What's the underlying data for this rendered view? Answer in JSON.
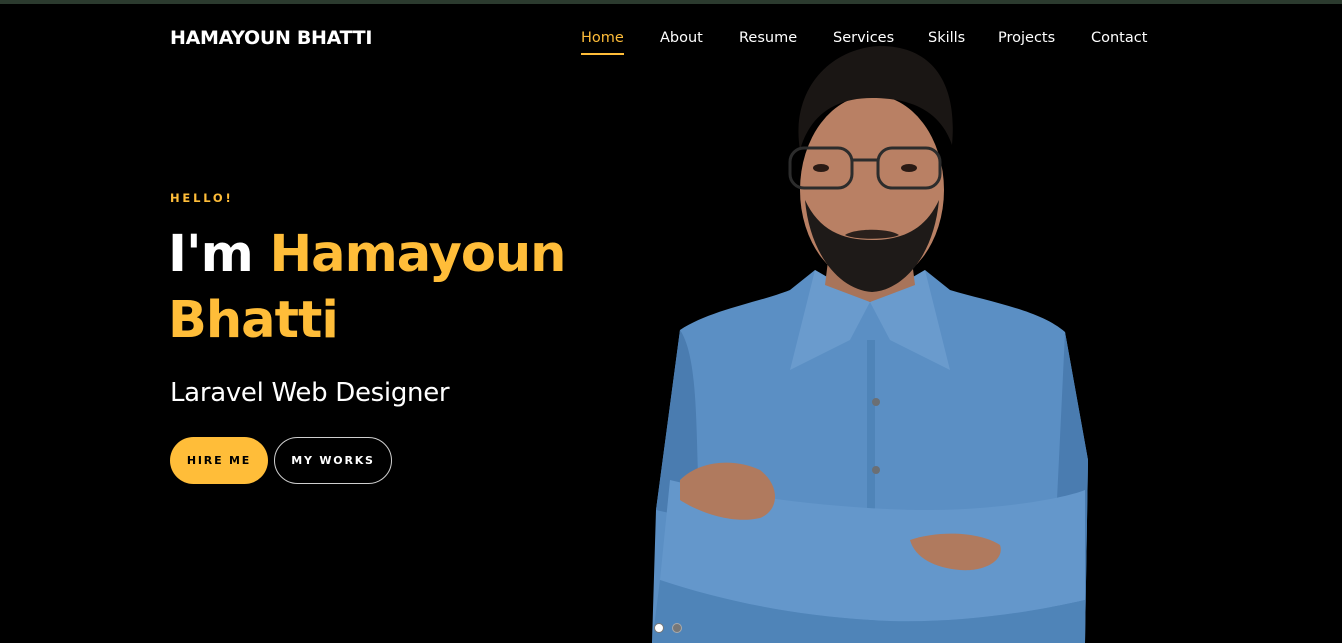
{
  "brand": {
    "name": "HAMAYOUN BHATTI"
  },
  "nav": {
    "items": [
      {
        "label": "Home",
        "active": true
      },
      {
        "label": "About",
        "active": false
      },
      {
        "label": "Resume",
        "active": false
      },
      {
        "label": "Services",
        "active": false
      },
      {
        "label": "Skills",
        "active": false
      },
      {
        "label": "Projects",
        "active": false
      },
      {
        "label": "Contact",
        "active": false
      }
    ]
  },
  "hero": {
    "greeting": "HELLO!",
    "intro": "I'm",
    "name": "Hamayoun Bhatti",
    "role": "Laravel Web Designer",
    "hire_label": "HIRE ME",
    "works_label": "MY WORKS"
  },
  "slider": {
    "slide_count": 2,
    "active_index": 0
  },
  "colors": {
    "background": "#000000",
    "accent": "#ffbd39",
    "text": "#ffffff",
    "shirt": "#5b8fc4"
  },
  "icons": {
    "portrait": "person-portrait"
  }
}
